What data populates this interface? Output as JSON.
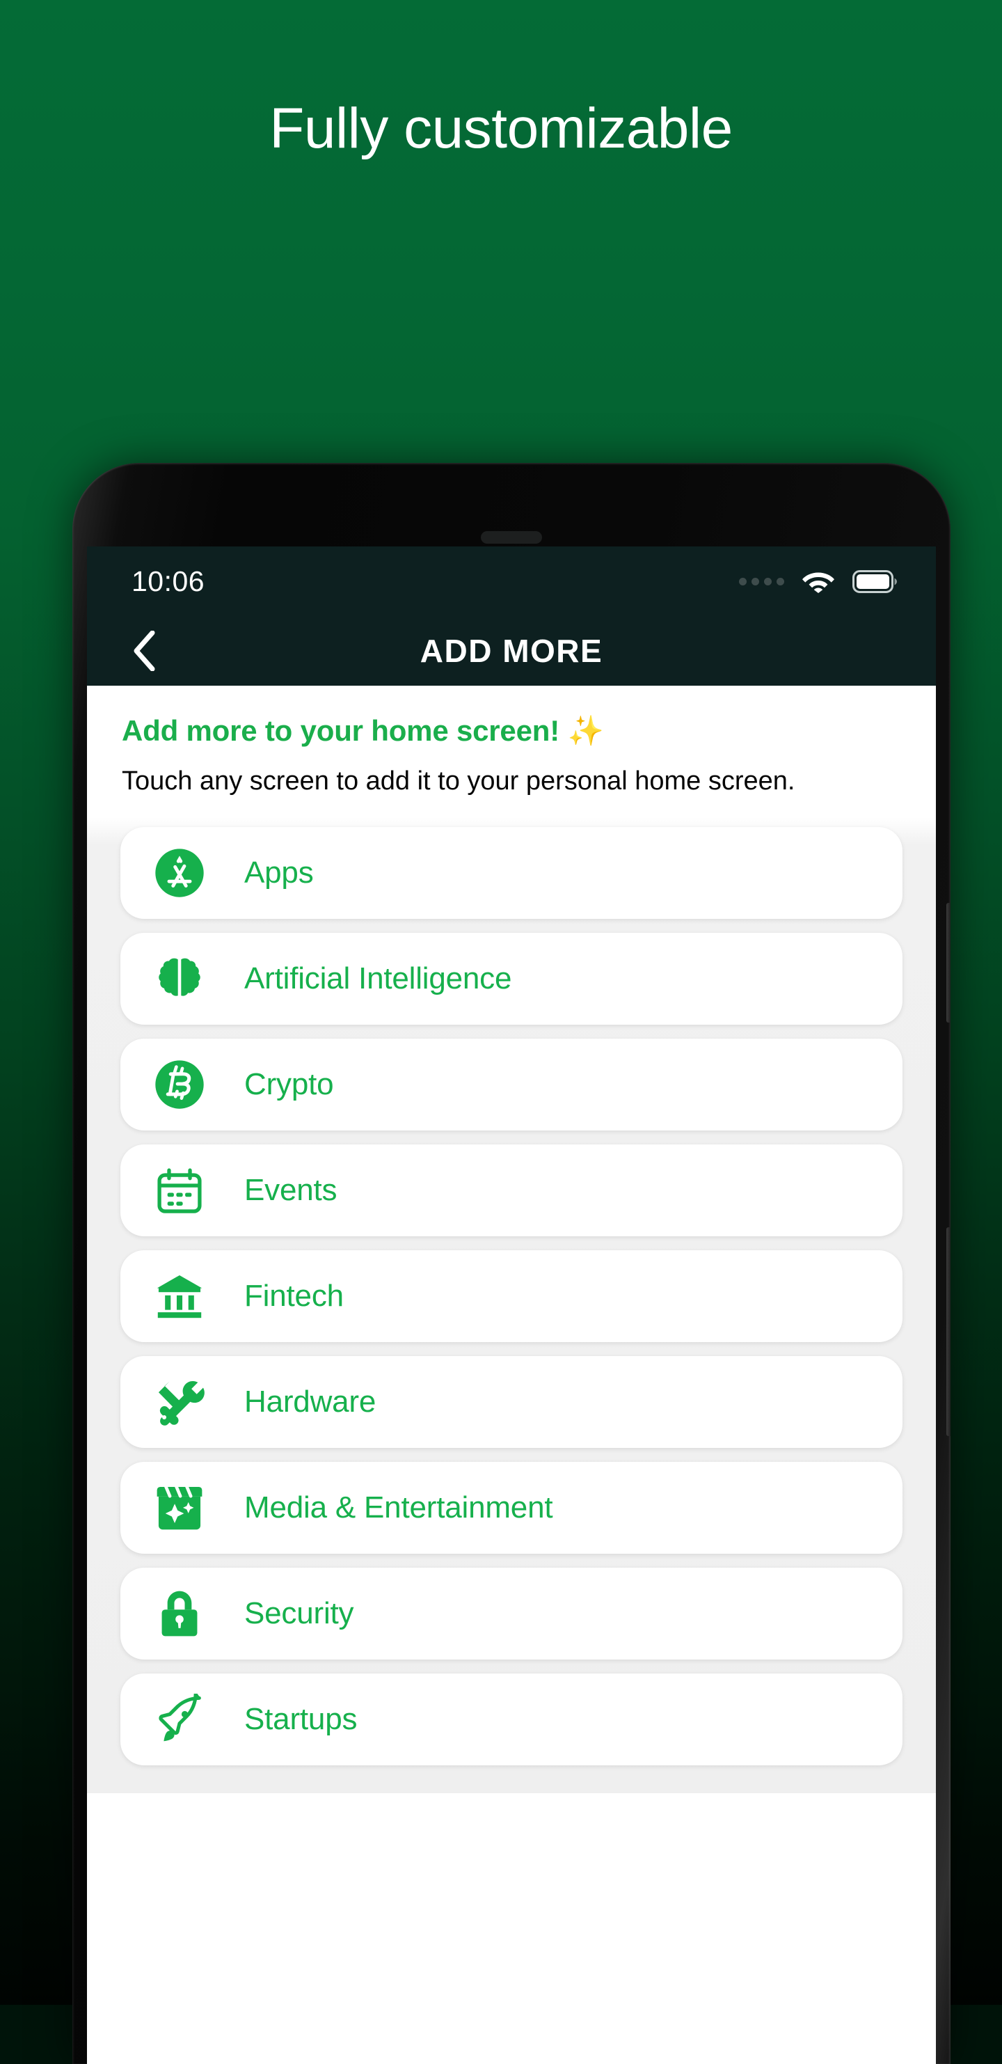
{
  "promo": {
    "headline": "Fully customizable",
    "bg_gradient_top": "#046b36",
    "bg_gradient_bottom": "#000402"
  },
  "phone": {
    "status_bar": {
      "time": "10:06",
      "signal_icon": "signal-dots-icon",
      "wifi_icon": "wifi-icon",
      "battery_icon": "battery-full-icon",
      "bg_color": "#0d2020"
    },
    "nav": {
      "back_icon": "chevron-left-icon",
      "title": "ADD MORE"
    },
    "intro": {
      "title": "Add more to your home screen! ✨",
      "subtitle": "Touch any screen to add it to your personal home screen."
    },
    "accent_color": "#16b04c",
    "categories": [
      {
        "label": "Apps",
        "icon": "app-store-icon"
      },
      {
        "label": "Artificial Intelligence",
        "icon": "brain-icon"
      },
      {
        "label": "Crypto",
        "icon": "bitcoin-icon"
      },
      {
        "label": "Events",
        "icon": "calendar-icon"
      },
      {
        "label": "Fintech",
        "icon": "bank-icon"
      },
      {
        "label": "Hardware",
        "icon": "tools-icon"
      },
      {
        "label": "Media & Entertainment",
        "icon": "clapperboard-icon"
      },
      {
        "label": "Security",
        "icon": "lock-icon"
      },
      {
        "label": "Startups",
        "icon": "rocket-icon"
      }
    ]
  }
}
